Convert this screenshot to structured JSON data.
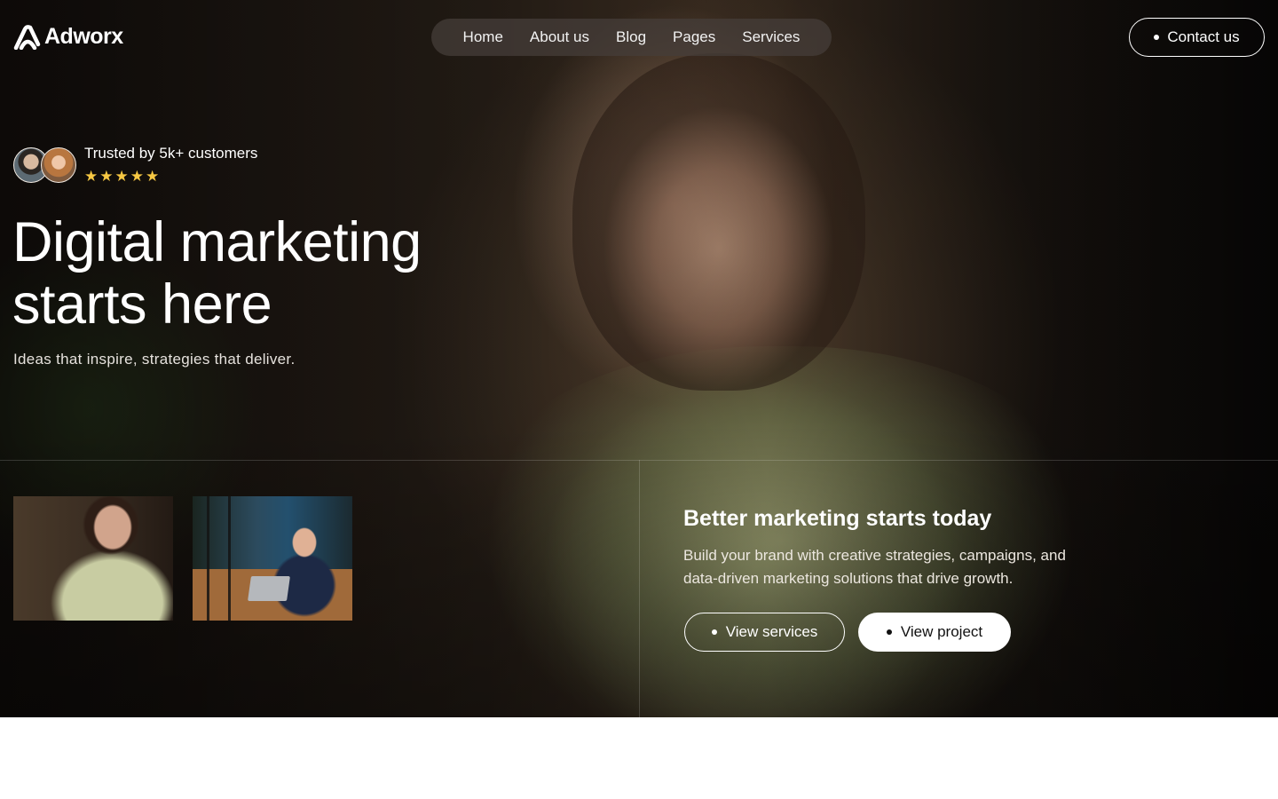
{
  "brand": {
    "name": "Adworx"
  },
  "nav": {
    "items": [
      {
        "label": "Home"
      },
      {
        "label": "About us"
      },
      {
        "label": "Blog"
      },
      {
        "label": "Pages"
      },
      {
        "label": "Services"
      }
    ],
    "contact_label": "Contact us"
  },
  "hero": {
    "trust_text": "Trusted by 5k+ customers",
    "rating_stars": 5,
    "headline_line1": "Digital marketing",
    "headline_line2": "starts here",
    "subline": "Ideas that inspire, strategies that deliver."
  },
  "panel": {
    "title": "Better marketing starts today",
    "description_line1": "Build your brand with creative strategies, campaigns, and",
    "description_line2": "data-driven marketing solutions that drive growth.",
    "primary_button": "View services",
    "secondary_button": "View project"
  },
  "colors": {
    "star": "#f7c843",
    "accent_button_bg": "#ffffff",
    "text": "#ffffff"
  },
  "icons": {
    "logo": "adworx-logo-icon",
    "rating": "star-icon",
    "bullet": "dot-icon"
  }
}
